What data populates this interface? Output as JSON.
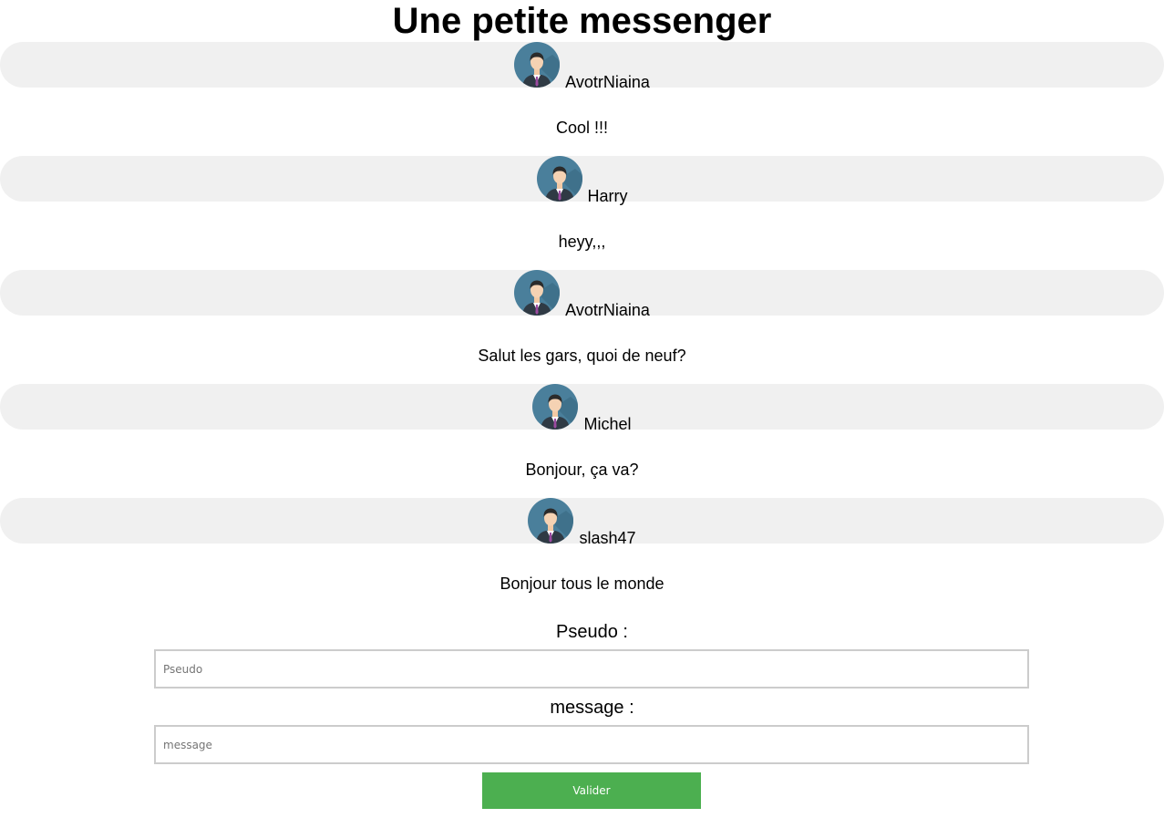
{
  "page": {
    "title": "Une petite messenger"
  },
  "messages": [
    {
      "user": "AvotrNiaina",
      "text": "Cool !!!",
      "avatar_icon": "user-avatar-icon"
    },
    {
      "user": "Harry",
      "text": "heyy,,,",
      "avatar_icon": "user-avatar-icon"
    },
    {
      "user": "AvotrNiaina",
      "text": "Salut les gars, quoi de neuf?",
      "avatar_icon": "user-avatar-icon"
    },
    {
      "user": "Michel",
      "text": "Bonjour, ça va?",
      "avatar_icon": "user-avatar-icon"
    },
    {
      "user": "slash47",
      "text": "Bonjour tous le monde",
      "avatar_icon": "user-avatar-icon"
    }
  ],
  "form": {
    "pseudo_label": "Pseudo :",
    "pseudo_placeholder": "Pseudo",
    "pseudo_value": "",
    "message_label": "message :",
    "message_placeholder": "message",
    "message_value": "",
    "submit_label": "Valider"
  },
  "colors": {
    "bubble_background": "#f0f0f0",
    "submit_background": "#4caf50",
    "submit_text": "#ffffff",
    "field_border": "#cccccc"
  }
}
